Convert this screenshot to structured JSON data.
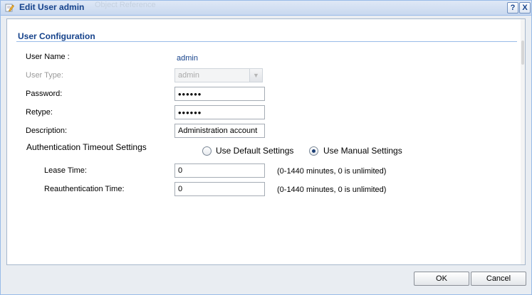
{
  "window": {
    "title": "Edit User admin",
    "background_title": "Object Reference",
    "help_button": "?",
    "close_button": "X"
  },
  "section": {
    "title": "User Configuration"
  },
  "fields": {
    "user_name": {
      "label": "User Name :",
      "value": "admin"
    },
    "user_type": {
      "label": "User Type:",
      "value": "admin"
    },
    "password": {
      "label": "Password:",
      "value": "••••••"
    },
    "retype": {
      "label": "Retype:",
      "value": "••••••"
    },
    "description": {
      "label": "Description:",
      "value": "Administration account"
    }
  },
  "auth_timeout": {
    "label": "Authentication Timeout Settings",
    "option_default": "Use Default Settings",
    "option_manual": "Use Manual Settings",
    "selected": "manual",
    "lease_time": {
      "label": "Lease Time:",
      "value": "0",
      "hint": "(0-1440 minutes, 0 is unlimited)"
    },
    "reauth_time": {
      "label": "Reauthentication Time:",
      "value": "0",
      "hint": "(0-1440 minutes, 0 is unlimited)"
    }
  },
  "buttons": {
    "ok": "OK",
    "cancel": "Cancel"
  },
  "colors": {
    "title_text": "#15428b",
    "frame_border": "#99bbe8",
    "dialog_bg": "#e9edf2"
  },
  "icons": {
    "title": "edit-pencil-icon",
    "select_arrow": "chevron-down-icon"
  }
}
